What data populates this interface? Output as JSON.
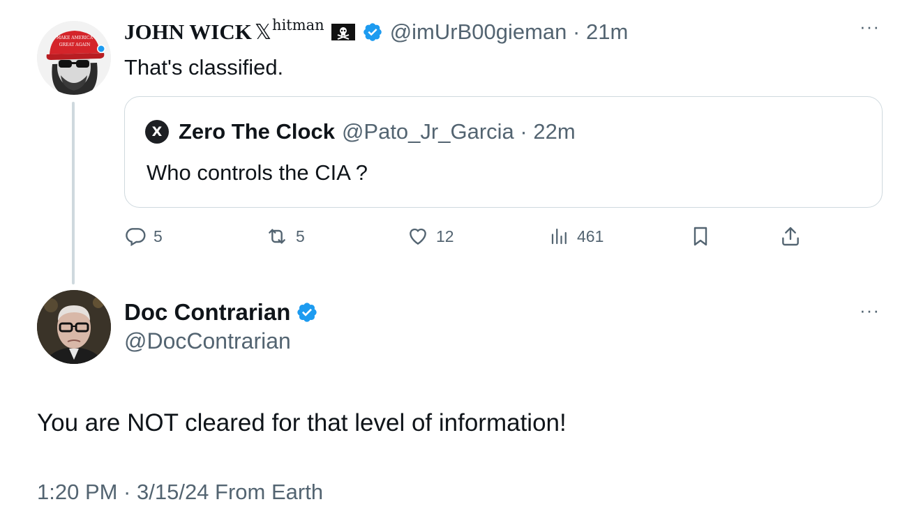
{
  "tweet1": {
    "display_name": "JOHN WICK",
    "name_symbol": "𝕏",
    "name_superscript": "hitman",
    "flag_icon": "pirate-flag-icon",
    "verified_icon": "verified-badge-icon",
    "handle_time": "@imUrB00gieman · 21m",
    "text": "That's classified.",
    "more_icon": "more-options-icon"
  },
  "quote": {
    "logo_glyph": "X",
    "display_name": "Zero The Clock",
    "handle_time": "@Pato_Jr_Garcia · 22m",
    "text": "Who controls the CIA  ?"
  },
  "actions": {
    "replies": "5",
    "reposts": "5",
    "likes": "12",
    "views": "461"
  },
  "tweet2": {
    "display_name": "Doc Contrarian",
    "handle": "@DocContrarian",
    "text": "You are NOT cleared for that level of information!",
    "meta": "1:20 PM · 3/15/24 From Earth"
  },
  "colors": {
    "text_primary": "#0f1419",
    "text_secondary": "#536471",
    "verified_blue": "#1d9bf0",
    "border": "#cfd9de",
    "maga_red": "#d4242a"
  }
}
